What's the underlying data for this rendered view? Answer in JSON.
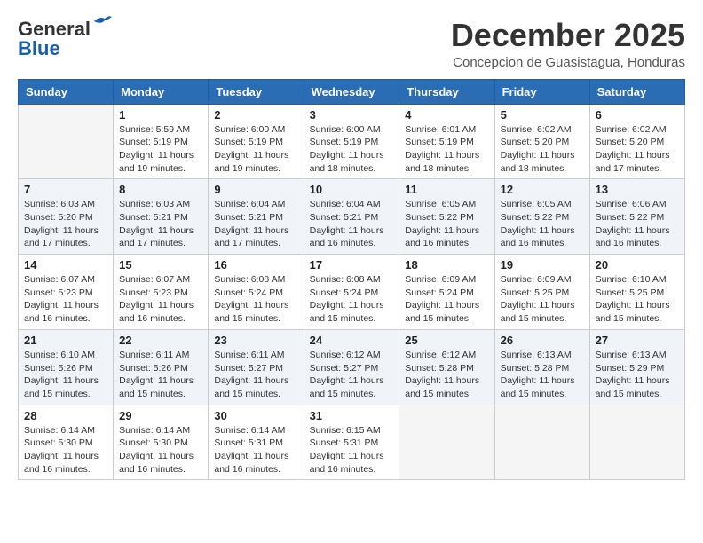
{
  "header": {
    "logo_line1": "General",
    "logo_line2": "Blue",
    "month": "December 2025",
    "location": "Concepcion de Guasistagua, Honduras"
  },
  "weekdays": [
    "Sunday",
    "Monday",
    "Tuesday",
    "Wednesday",
    "Thursday",
    "Friday",
    "Saturday"
  ],
  "rows": [
    [
      {
        "day": "",
        "sunrise": "",
        "sunset": "",
        "daylight": ""
      },
      {
        "day": "1",
        "sunrise": "Sunrise: 5:59 AM",
        "sunset": "Sunset: 5:19 PM",
        "daylight": "Daylight: 11 hours and 19 minutes."
      },
      {
        "day": "2",
        "sunrise": "Sunrise: 6:00 AM",
        "sunset": "Sunset: 5:19 PM",
        "daylight": "Daylight: 11 hours and 19 minutes."
      },
      {
        "day": "3",
        "sunrise": "Sunrise: 6:00 AM",
        "sunset": "Sunset: 5:19 PM",
        "daylight": "Daylight: 11 hours and 18 minutes."
      },
      {
        "day": "4",
        "sunrise": "Sunrise: 6:01 AM",
        "sunset": "Sunset: 5:19 PM",
        "daylight": "Daylight: 11 hours and 18 minutes."
      },
      {
        "day": "5",
        "sunrise": "Sunrise: 6:02 AM",
        "sunset": "Sunset: 5:20 PM",
        "daylight": "Daylight: 11 hours and 18 minutes."
      },
      {
        "day": "6",
        "sunrise": "Sunrise: 6:02 AM",
        "sunset": "Sunset: 5:20 PM",
        "daylight": "Daylight: 11 hours and 17 minutes."
      }
    ],
    [
      {
        "day": "7",
        "sunrise": "Sunrise: 6:03 AM",
        "sunset": "Sunset: 5:20 PM",
        "daylight": "Daylight: 11 hours and 17 minutes."
      },
      {
        "day": "8",
        "sunrise": "Sunrise: 6:03 AM",
        "sunset": "Sunset: 5:21 PM",
        "daylight": "Daylight: 11 hours and 17 minutes."
      },
      {
        "day": "9",
        "sunrise": "Sunrise: 6:04 AM",
        "sunset": "Sunset: 5:21 PM",
        "daylight": "Daylight: 11 hours and 17 minutes."
      },
      {
        "day": "10",
        "sunrise": "Sunrise: 6:04 AM",
        "sunset": "Sunset: 5:21 PM",
        "daylight": "Daylight: 11 hours and 16 minutes."
      },
      {
        "day": "11",
        "sunrise": "Sunrise: 6:05 AM",
        "sunset": "Sunset: 5:22 PM",
        "daylight": "Daylight: 11 hours and 16 minutes."
      },
      {
        "day": "12",
        "sunrise": "Sunrise: 6:05 AM",
        "sunset": "Sunset: 5:22 PM",
        "daylight": "Daylight: 11 hours and 16 minutes."
      },
      {
        "day": "13",
        "sunrise": "Sunrise: 6:06 AM",
        "sunset": "Sunset: 5:22 PM",
        "daylight": "Daylight: 11 hours and 16 minutes."
      }
    ],
    [
      {
        "day": "14",
        "sunrise": "Sunrise: 6:07 AM",
        "sunset": "Sunset: 5:23 PM",
        "daylight": "Daylight: 11 hours and 16 minutes."
      },
      {
        "day": "15",
        "sunrise": "Sunrise: 6:07 AM",
        "sunset": "Sunset: 5:23 PM",
        "daylight": "Daylight: 11 hours and 16 minutes."
      },
      {
        "day": "16",
        "sunrise": "Sunrise: 6:08 AM",
        "sunset": "Sunset: 5:24 PM",
        "daylight": "Daylight: 11 hours and 15 minutes."
      },
      {
        "day": "17",
        "sunrise": "Sunrise: 6:08 AM",
        "sunset": "Sunset: 5:24 PM",
        "daylight": "Daylight: 11 hours and 15 minutes."
      },
      {
        "day": "18",
        "sunrise": "Sunrise: 6:09 AM",
        "sunset": "Sunset: 5:24 PM",
        "daylight": "Daylight: 11 hours and 15 minutes."
      },
      {
        "day": "19",
        "sunrise": "Sunrise: 6:09 AM",
        "sunset": "Sunset: 5:25 PM",
        "daylight": "Daylight: 11 hours and 15 minutes."
      },
      {
        "day": "20",
        "sunrise": "Sunrise: 6:10 AM",
        "sunset": "Sunset: 5:25 PM",
        "daylight": "Daylight: 11 hours and 15 minutes."
      }
    ],
    [
      {
        "day": "21",
        "sunrise": "Sunrise: 6:10 AM",
        "sunset": "Sunset: 5:26 PM",
        "daylight": "Daylight: 11 hours and 15 minutes."
      },
      {
        "day": "22",
        "sunrise": "Sunrise: 6:11 AM",
        "sunset": "Sunset: 5:26 PM",
        "daylight": "Daylight: 11 hours and 15 minutes."
      },
      {
        "day": "23",
        "sunrise": "Sunrise: 6:11 AM",
        "sunset": "Sunset: 5:27 PM",
        "daylight": "Daylight: 11 hours and 15 minutes."
      },
      {
        "day": "24",
        "sunrise": "Sunrise: 6:12 AM",
        "sunset": "Sunset: 5:27 PM",
        "daylight": "Daylight: 11 hours and 15 minutes."
      },
      {
        "day": "25",
        "sunrise": "Sunrise: 6:12 AM",
        "sunset": "Sunset: 5:28 PM",
        "daylight": "Daylight: 11 hours and 15 minutes."
      },
      {
        "day": "26",
        "sunrise": "Sunrise: 6:13 AM",
        "sunset": "Sunset: 5:28 PM",
        "daylight": "Daylight: 11 hours and 15 minutes."
      },
      {
        "day": "27",
        "sunrise": "Sunrise: 6:13 AM",
        "sunset": "Sunset: 5:29 PM",
        "daylight": "Daylight: 11 hours and 15 minutes."
      }
    ],
    [
      {
        "day": "28",
        "sunrise": "Sunrise: 6:14 AM",
        "sunset": "Sunset: 5:30 PM",
        "daylight": "Daylight: 11 hours and 16 minutes."
      },
      {
        "day": "29",
        "sunrise": "Sunrise: 6:14 AM",
        "sunset": "Sunset: 5:30 PM",
        "daylight": "Daylight: 11 hours and 16 minutes."
      },
      {
        "day": "30",
        "sunrise": "Sunrise: 6:14 AM",
        "sunset": "Sunset: 5:31 PM",
        "daylight": "Daylight: 11 hours and 16 minutes."
      },
      {
        "day": "31",
        "sunrise": "Sunrise: 6:15 AM",
        "sunset": "Sunset: 5:31 PM",
        "daylight": "Daylight: 11 hours and 16 minutes."
      },
      {
        "day": "",
        "sunrise": "",
        "sunset": "",
        "daylight": ""
      },
      {
        "day": "",
        "sunrise": "",
        "sunset": "",
        "daylight": ""
      },
      {
        "day": "",
        "sunrise": "",
        "sunset": "",
        "daylight": ""
      }
    ]
  ]
}
